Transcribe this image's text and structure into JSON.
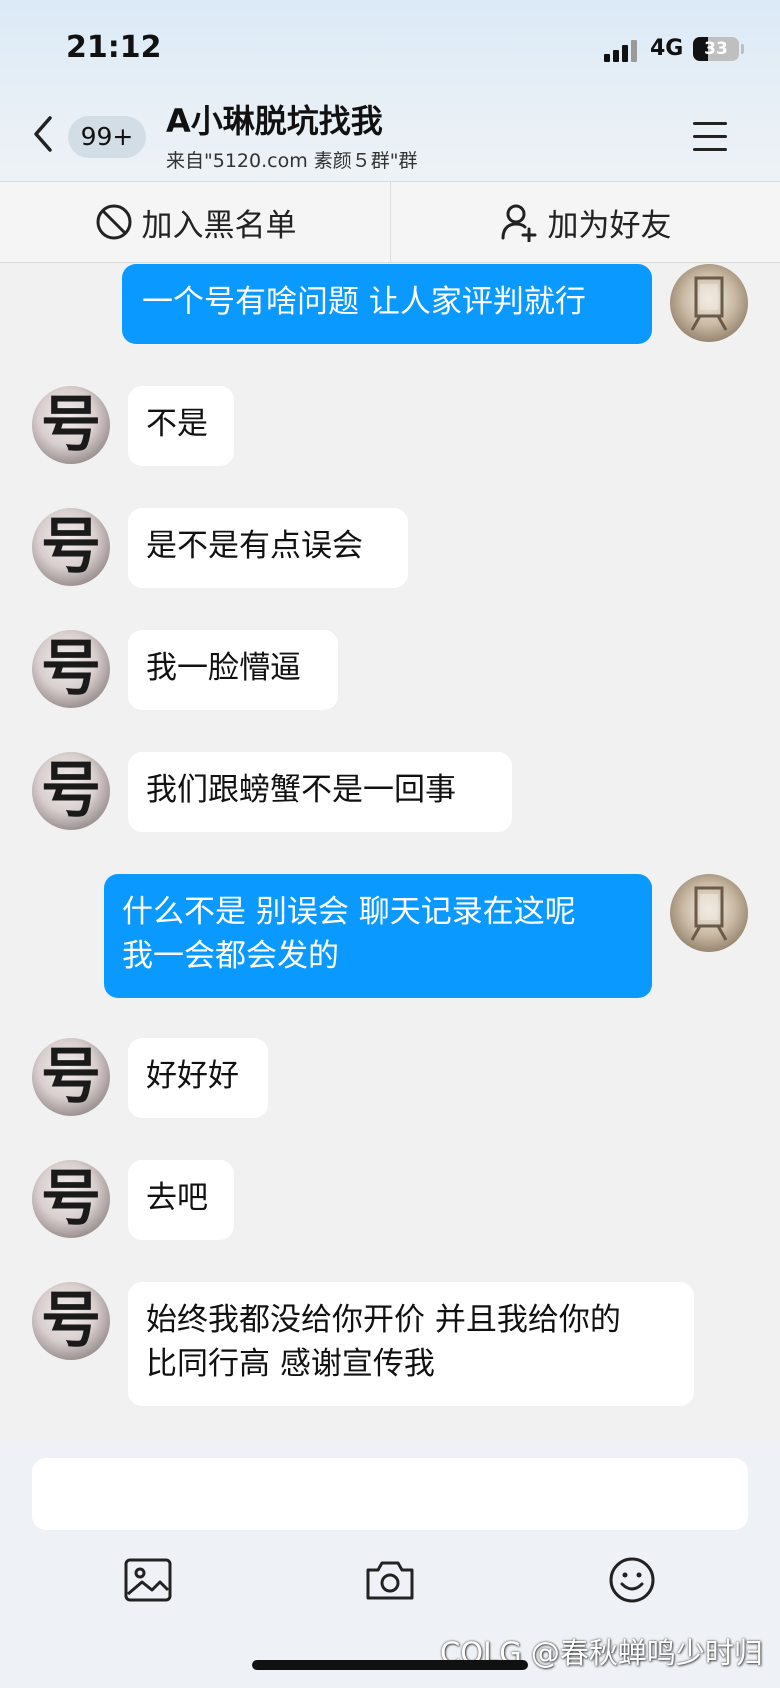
{
  "status_bar": {
    "time": "21:12",
    "network": "4G",
    "battery": "33",
    "battery_level": 0.33
  },
  "header": {
    "unread_count": "99+",
    "title": "A小琳脱坑找我",
    "subtitle": "来自\"5120.com 素颜５群\"群"
  },
  "actions": {
    "blacklist": "加入黑名单",
    "add_friend": "加为好友"
  },
  "contact_avatar_glyph": "号",
  "messages": [
    {
      "from": "self",
      "lines": [
        "一个号有啥问题 让人家评判就行"
      ]
    },
    {
      "from": "contact",
      "lines": [
        "不是"
      ]
    },
    {
      "from": "contact",
      "lines": [
        "是不是有点误会"
      ]
    },
    {
      "from": "contact",
      "lines": [
        "我一脸懵逼"
      ]
    },
    {
      "from": "contact",
      "lines": [
        "我们跟螃蟹不是一回事"
      ]
    },
    {
      "from": "self",
      "lines": [
        "什么不是 别误会 聊天记录在这呢",
        "我一会都会发的"
      ]
    },
    {
      "from": "contact",
      "lines": [
        "好好好"
      ]
    },
    {
      "from": "contact",
      "lines": [
        "去吧"
      ]
    },
    {
      "from": "contact",
      "lines": [
        "始终我都没给你开价 并且我给你的",
        "比同行高 感谢宣传我"
      ]
    }
  ],
  "toolbar": {
    "icons": [
      "image-icon",
      "camera-icon",
      "emoji-icon"
    ]
  },
  "watermark": "COLG @春秋蝉鸣少时归",
  "colors": {
    "outgoing_bubble": "#0a99ff",
    "incoming_bubble": "#ffffff",
    "chat_background": "#f1f1f1"
  }
}
